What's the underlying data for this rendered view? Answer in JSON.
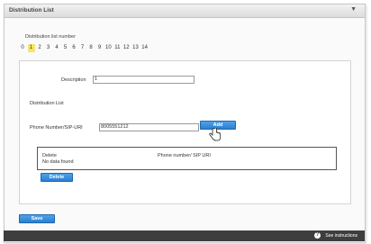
{
  "window": {
    "title": "Distribution List",
    "collapse_icon": "▼"
  },
  "list_number": {
    "label": "Distribution list number",
    "numbers": [
      "0",
      "1",
      "2",
      "3",
      "4",
      "5",
      "6",
      "7",
      "8",
      "9",
      "10",
      "11",
      "12",
      "13",
      "14"
    ],
    "selected": "1"
  },
  "form": {
    "description_label": "Description",
    "description_value": "1",
    "distribution_list_label": "Distribution List",
    "phone_label": "Phone Number/SIP-URI",
    "phone_value": "8005551212",
    "add_label": "Add"
  },
  "table": {
    "col_delete": "Delete",
    "col_phone": "Phone number/ SIP URI",
    "empty_text": "No data found"
  },
  "buttons": {
    "delete_label": "Delete",
    "save_label": "Save"
  },
  "footer": {
    "info_icon": "?",
    "instructions_label": "See instructions"
  },
  "colors": {
    "accent": "#2a7fd0",
    "selected_highlight": "#f6e56a",
    "footer": "#3e3e3e"
  }
}
